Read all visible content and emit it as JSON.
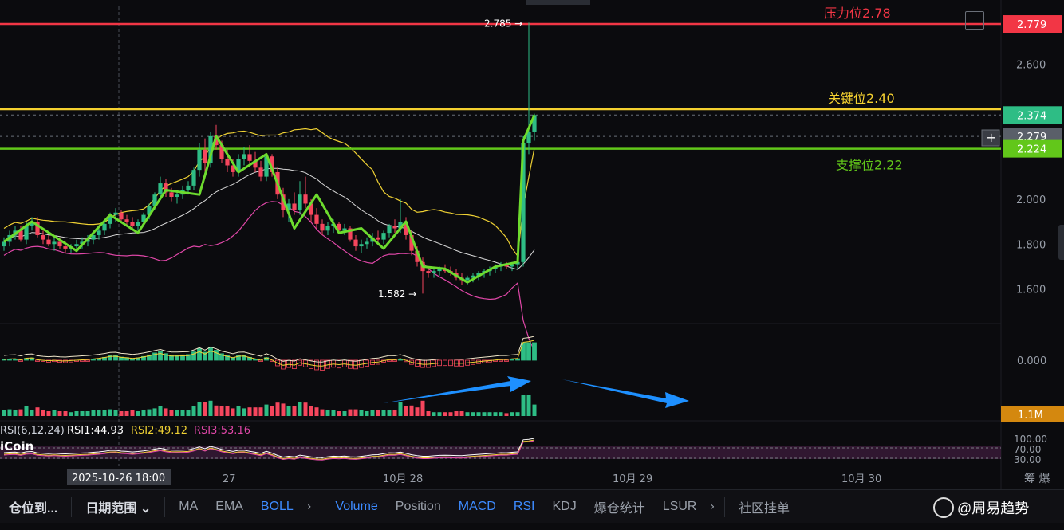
{
  "colors": {
    "bg": "#0b0b0e",
    "up": "#2ebd85",
    "down": "#f6465d",
    "trend": "#6ddb2e",
    "boll_upper": "#f0d234",
    "boll_mid": "#d9d9d9",
    "boll_lower": "#e047a8",
    "resistance": "#f23645",
    "key": "#f5d130",
    "support": "#62c71a",
    "arrow": "#1e90ff",
    "macd_dif": "#f0e6c8",
    "macd_dea": "#f0d234"
  },
  "chart_data": {
    "type": "candlestick",
    "symbol_source": "iCoin",
    "price_axis": {
      "ylim": [
        1.45,
        2.85
      ],
      "ticks": [
        "2.600",
        "2.000",
        "1.800",
        "1.600"
      ],
      "labels": [
        {
          "value": 2.779,
          "text": "2.779",
          "color": "#f23645"
        },
        {
          "value": 2.374,
          "text": "2.374",
          "color": "#2ebd85"
        },
        {
          "value": 2.279,
          "text": "2.279",
          "color": "#5a5f69"
        },
        {
          "value": 2.224,
          "text": "2.224",
          "color": "#62c71a"
        }
      ]
    },
    "x_axis": {
      "labels": [
        "2025-10-26 18:00",
        "27",
        "10月 28",
        "10月 29",
        "10月 30"
      ],
      "label_index": [
        0,
        12,
        50,
        88,
        126
      ],
      "count": 140
    },
    "candles": [
      [
        1.79,
        1.83,
        1.77,
        1.81
      ],
      [
        1.81,
        1.86,
        1.79,
        1.84
      ],
      [
        1.84,
        1.88,
        1.82,
        1.86
      ],
      [
        1.86,
        1.88,
        1.81,
        1.82
      ],
      [
        1.82,
        1.9,
        1.8,
        1.88
      ],
      [
        1.88,
        1.92,
        1.86,
        1.9
      ],
      [
        1.9,
        1.92,
        1.83,
        1.84
      ],
      [
        1.84,
        1.86,
        1.8,
        1.82
      ],
      [
        1.82,
        1.84,
        1.79,
        1.8
      ],
      [
        1.8,
        1.83,
        1.77,
        1.81
      ],
      [
        1.81,
        1.83,
        1.78,
        1.79
      ],
      [
        1.79,
        1.81,
        1.76,
        1.78
      ],
      [
        1.78,
        1.8,
        1.76,
        1.79
      ],
      [
        1.79,
        1.82,
        1.77,
        1.8
      ],
      [
        1.8,
        1.83,
        1.78,
        1.81
      ],
      [
        1.81,
        1.84,
        1.79,
        1.82
      ],
      [
        1.82,
        1.86,
        1.8,
        1.84
      ],
      [
        1.84,
        1.88,
        1.82,
        1.86
      ],
      [
        1.86,
        1.9,
        1.84,
        1.89
      ],
      [
        1.89,
        1.94,
        1.87,
        1.93
      ],
      [
        1.93,
        1.96,
        1.9,
        1.94
      ],
      [
        1.94,
        1.95,
        1.9,
        1.91
      ],
      [
        1.91,
        1.93,
        1.88,
        1.9
      ],
      [
        1.9,
        1.92,
        1.86,
        1.88
      ],
      [
        1.88,
        1.91,
        1.86,
        1.9
      ],
      [
        1.9,
        1.94,
        1.88,
        1.93
      ],
      [
        1.93,
        1.98,
        1.91,
        1.97
      ],
      [
        1.97,
        2.03,
        1.95,
        2.02
      ],
      [
        2.02,
        2.1,
        2.0,
        2.07
      ],
      [
        2.07,
        2.09,
        2.01,
        2.03
      ],
      [
        2.03,
        2.05,
        1.99,
        2.01
      ],
      [
        2.01,
        2.04,
        1.98,
        2.02
      ],
      [
        2.02,
        2.06,
        2.0,
        2.04
      ],
      [
        2.04,
        2.08,
        2.02,
        2.06
      ],
      [
        2.06,
        2.14,
        2.04,
        2.13
      ],
      [
        2.13,
        2.25,
        2.1,
        2.22
      ],
      [
        2.22,
        2.27,
        2.12,
        2.16
      ],
      [
        2.16,
        2.3,
        2.14,
        2.28
      ],
      [
        2.28,
        2.33,
        2.22,
        2.24
      ],
      [
        2.24,
        2.26,
        2.16,
        2.18
      ],
      [
        2.18,
        2.22,
        2.12,
        2.15
      ],
      [
        2.15,
        2.18,
        2.1,
        2.12
      ],
      [
        2.12,
        2.2,
        2.1,
        2.18
      ],
      [
        2.18,
        2.23,
        2.15,
        2.2
      ],
      [
        2.2,
        2.24,
        2.15,
        2.17
      ],
      [
        2.17,
        2.21,
        2.12,
        2.14
      ],
      [
        2.14,
        2.17,
        2.08,
        2.1
      ],
      [
        2.1,
        2.2,
        2.08,
        2.19
      ],
      [
        2.19,
        2.2,
        2.1,
        2.12
      ],
      [
        2.12,
        2.14,
        2.0,
        2.02
      ],
      [
        2.02,
        2.05,
        1.92,
        1.95
      ],
      [
        1.95,
        2.0,
        1.9,
        1.98
      ],
      [
        1.98,
        2.03,
        1.93,
        1.95
      ],
      [
        1.95,
        2.08,
        1.93,
        2.02
      ],
      [
        2.02,
        2.1,
        1.96,
        1.98
      ],
      [
        1.98,
        2.0,
        1.9,
        1.93
      ],
      [
        1.93,
        1.96,
        1.87,
        1.89
      ],
      [
        1.89,
        1.91,
        1.84,
        1.86
      ],
      [
        1.86,
        1.9,
        1.84,
        1.88
      ],
      [
        1.88,
        1.91,
        1.85,
        1.89
      ],
      [
        1.89,
        1.9,
        1.85,
        1.86
      ],
      [
        1.86,
        1.89,
        1.84,
        1.87
      ],
      [
        1.87,
        1.88,
        1.81,
        1.82
      ],
      [
        1.82,
        1.84,
        1.77,
        1.79
      ],
      [
        1.79,
        1.82,
        1.76,
        1.8
      ],
      [
        1.8,
        1.83,
        1.78,
        1.81
      ],
      [
        1.81,
        1.85,
        1.79,
        1.83
      ],
      [
        1.83,
        1.86,
        1.8,
        1.82
      ],
      [
        1.82,
        1.86,
        1.8,
        1.85
      ],
      [
        1.85,
        1.89,
        1.83,
        1.88
      ],
      [
        1.88,
        1.91,
        1.85,
        1.87
      ],
      [
        1.87,
        2.0,
        1.85,
        1.9
      ],
      [
        1.9,
        1.92,
        1.82,
        1.84
      ],
      [
        1.84,
        1.86,
        1.75,
        1.77
      ],
      [
        1.77,
        1.79,
        1.7,
        1.72
      ],
      [
        1.72,
        1.74,
        1.58,
        1.68
      ],
      [
        1.68,
        1.7,
        1.65,
        1.67
      ],
      [
        1.67,
        1.69,
        1.65,
        1.68
      ],
      [
        1.68,
        1.7,
        1.66,
        1.69
      ],
      [
        1.69,
        1.71,
        1.67,
        1.68
      ],
      [
        1.68,
        1.7,
        1.66,
        1.67
      ],
      [
        1.67,
        1.69,
        1.64,
        1.65
      ],
      [
        1.65,
        1.67,
        1.62,
        1.64
      ],
      [
        1.64,
        1.66,
        1.62,
        1.65
      ],
      [
        1.65,
        1.67,
        1.63,
        1.66
      ],
      [
        1.66,
        1.68,
        1.64,
        1.67
      ],
      [
        1.67,
        1.69,
        1.65,
        1.68
      ],
      [
        1.68,
        1.7,
        1.66,
        1.69
      ],
      [
        1.69,
        1.71,
        1.67,
        1.7
      ],
      [
        1.7,
        1.72,
        1.68,
        1.71
      ],
      [
        1.71,
        1.72,
        1.69,
        1.7
      ],
      [
        1.7,
        1.72,
        1.68,
        1.71
      ],
      [
        1.71,
        1.73,
        1.69,
        1.72
      ],
      [
        1.72,
        2.28,
        1.7,
        2.25
      ],
      [
        2.25,
        2.785,
        2.2,
        2.3
      ],
      [
        2.3,
        2.38,
        2.26,
        2.374
      ]
    ],
    "trend_line": [
      [
        0,
        1.81
      ],
      [
        5,
        1.9
      ],
      [
        13,
        1.77
      ],
      [
        19,
        1.93
      ],
      [
        24,
        1.85
      ],
      [
        29,
        2.04
      ],
      [
        35,
        2.02
      ],
      [
        38,
        2.28
      ],
      [
        42,
        2.12
      ],
      [
        47,
        2.2
      ],
      [
        52,
        1.87
      ],
      [
        56,
        2.02
      ],
      [
        60,
        1.85
      ],
      [
        64,
        1.87
      ],
      [
        68,
        1.78
      ],
      [
        72,
        1.9
      ],
      [
        75,
        1.7
      ],
      [
        79,
        1.69
      ],
      [
        83,
        1.63
      ],
      [
        88,
        1.7
      ],
      [
        92,
        1.72
      ],
      [
        93,
        2.26
      ],
      [
        95,
        2.374
      ]
    ],
    "annotations": [
      {
        "text": "2.785",
        "index": 94,
        "value": 2.785,
        "arrow": "→"
      },
      {
        "text": "1.582",
        "index": 75,
        "value": 1.582,
        "arrow": "→"
      }
    ],
    "levels": [
      {
        "name": "压力位2.78",
        "value": 2.779,
        "color": "#f23645"
      },
      {
        "name": "关键位2.40",
        "value": 2.4,
        "color": "#f5d130"
      },
      {
        "name": "支撑位2.22",
        "value": 2.224,
        "color": "#62c71a"
      }
    ],
    "macd_axis_label": "0.000",
    "volume_axis_label": "1.1M",
    "rsi": {
      "header": "RSI(6,12,24)",
      "rsi1": "RSI1:44.93",
      "rsi2": "RSI2:49.12",
      "rsi3": "RSI3:53.16",
      "ticks": [
        "100.00",
        "70.00",
        "30.00"
      ]
    }
  },
  "toolbar": {
    "items": [
      {
        "label": "仓位到...",
        "style": "bold"
      },
      {
        "label": "日期范围",
        "style": "bold",
        "chevron": "⌄"
      },
      {
        "label": "MA"
      },
      {
        "label": "EMA"
      },
      {
        "label": "BOLL",
        "style": "active"
      },
      {
        "label": "Volume",
        "style": "active"
      },
      {
        "label": "Position"
      },
      {
        "label": "MACD",
        "style": "active"
      },
      {
        "label": "RSI",
        "style": "active"
      },
      {
        "label": "KDJ"
      },
      {
        "label": "爆仓统计"
      },
      {
        "label": "LSUR"
      },
      {
        "label": "社区挂单"
      }
    ],
    "right_labels": [
      "筹",
      "爆"
    ]
  },
  "watermark": "@周易趋势"
}
